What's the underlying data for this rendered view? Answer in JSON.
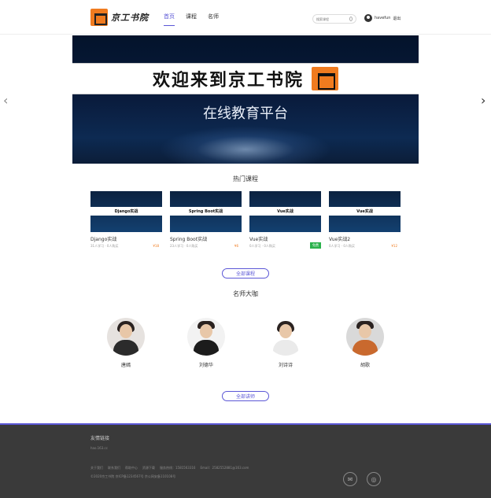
{
  "header": {
    "logo_text": "京工书院",
    "nav": [
      "首页",
      "课程",
      "名师"
    ],
    "search_placeholder": "搜索课程",
    "username": "havefun",
    "logout": "退出"
  },
  "banner": {
    "title": "欢迎来到京工书院",
    "subtitle": "在线教育平台"
  },
  "hot_courses": {
    "title": "热门课程",
    "items": [
      {
        "thumb": "Django实战",
        "name": "Django实战",
        "meta": "31人学习 · 0人购买",
        "price": "¥18"
      },
      {
        "thumb": "Spring Boot实战",
        "name": "Spring Boot实战",
        "meta": "23人学习 · 0人购买",
        "price": "¥6"
      },
      {
        "thumb": "Vue实战",
        "name": "Vue实战",
        "meta": "0人学习 · 0人购买",
        "price": "免费"
      },
      {
        "thumb": "Vue实战",
        "name": "Vue实战2",
        "meta": "0人学习 · 0人购买",
        "price": "¥12"
      }
    ],
    "all_button": "全部课程"
  },
  "teachers": {
    "title": "名师大咖",
    "items": [
      {
        "name": "唐嫣"
      },
      {
        "name": "刘德华"
      },
      {
        "name": "刘诗诗"
      },
      {
        "name": "胡歌"
      }
    ],
    "all_button": "全部讲师"
  },
  "footer": {
    "title": "友情链接",
    "link": "hao.163.cc",
    "links": [
      "关于我们",
      "联系我们",
      "帮助中心",
      "资源下载",
      "服务热线：1581563316",
      "Email：2582552881@163.com"
    ],
    "copyright": "©2020京工书院 京ICP备1234567号 京公网安备110108号",
    "social_icons": [
      "wechat-icon",
      "weibo-icon"
    ]
  },
  "colors": {
    "accent": "#5b57d6",
    "brand_orange": "#f07b1f",
    "free_green": "#2bb24c",
    "footer_bg": "#3a3a3a"
  }
}
